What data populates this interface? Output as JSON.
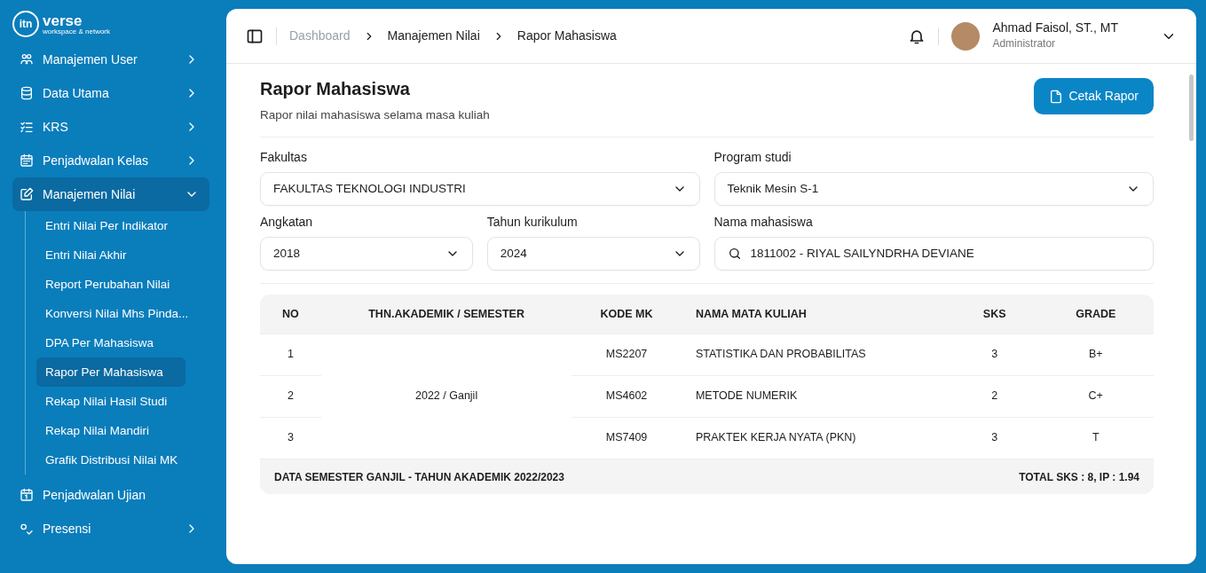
{
  "logo": {
    "mark": "itn",
    "name": "verse",
    "tagline": "workspace & network"
  },
  "sidebar": {
    "items": [
      {
        "label": "Manajemen User",
        "kind": "group",
        "expanded": false
      },
      {
        "label": "Data Utama",
        "kind": "group",
        "expanded": false
      },
      {
        "label": "KRS",
        "kind": "group",
        "expanded": false
      },
      {
        "label": "Penjadwalan Kelas",
        "kind": "group",
        "expanded": false
      },
      {
        "label": "Manajemen Nilai",
        "kind": "group",
        "expanded": true,
        "children": [
          {
            "label": "Entri Nilai Per Indikator",
            "selected": false
          },
          {
            "label": "Entri Nilai Akhir",
            "selected": false
          },
          {
            "label": "Report Perubahan Nilai",
            "selected": false
          },
          {
            "label": "Konversi Nilai Mhs Pinda...",
            "selected": false
          },
          {
            "label": "DPA Per Mahasiswa",
            "selected": false
          },
          {
            "label": "Rapor Per Mahasiswa",
            "selected": true
          },
          {
            "label": "Rekap Nilai Hasil Studi",
            "selected": false
          },
          {
            "label": "Rekap Nilai Mandiri",
            "selected": false
          },
          {
            "label": "Grafik Distribusi Nilai MK",
            "selected": false
          }
        ]
      },
      {
        "label": "Penjadwalan Ujian",
        "kind": "link"
      },
      {
        "label": "Presensi",
        "kind": "group",
        "expanded": false
      }
    ]
  },
  "breadcrumb": [
    {
      "label": "Dashboard",
      "muted": true
    },
    {
      "label": "Manajemen Nilai",
      "muted": false
    },
    {
      "label": "Rapor Mahasiswa",
      "muted": false
    }
  ],
  "user": {
    "name": "Ahmad Faisol, ST., MT",
    "role": "Administrator"
  },
  "page": {
    "title": "Rapor Mahasiswa",
    "subtitle": "Rapor nilai mahasiswa selama masa kuliah",
    "print_button": "Cetak Rapor"
  },
  "filters": [
    [
      {
        "label": "Fakultas",
        "value": "FAKULTAS TEKNOLOGI INDUSTRI",
        "kind": "select"
      },
      {
        "label": "Program studi",
        "value": "Teknik Mesin S-1",
        "kind": "select"
      }
    ],
    [
      {
        "label": "Angkatan",
        "value": "2018",
        "kind": "select"
      },
      {
        "label": "Tahun kurikulum",
        "value": "2024",
        "kind": "select"
      },
      {
        "label": "Nama mahasiswa",
        "value": "1811002 - RIYAL SAILYNDRHA DEVIANE",
        "kind": "search"
      }
    ]
  ],
  "table": {
    "columns": [
      "NO",
      "THN.AKADEMIK / SEMESTER",
      "KODE MK",
      "NAMA MATA KULIAH",
      "SKS",
      "GRADE"
    ],
    "groups": [
      {
        "semester": "2022 / Ganjil",
        "rows": [
          {
            "no": "1",
            "code": "MS2207",
            "name": "STATISTIKA DAN PROBABILITAS",
            "sks": "3",
            "grade": "B+"
          },
          {
            "no": "2",
            "code": "MS4602",
            "name": "METODE NUMERIK",
            "sks": "2",
            "grade": "C+"
          },
          {
            "no": "3",
            "code": "MS7409",
            "name": "PRAKTEK KERJA NYATA (PKN)",
            "sks": "3",
            "grade": "T"
          }
        ],
        "summary": "DATA SEMESTER GANJIL - TAHUN AKADEMIK 2022/2023",
        "total": "TOTAL SKS : 8, IP : 1.94"
      }
    ]
  }
}
